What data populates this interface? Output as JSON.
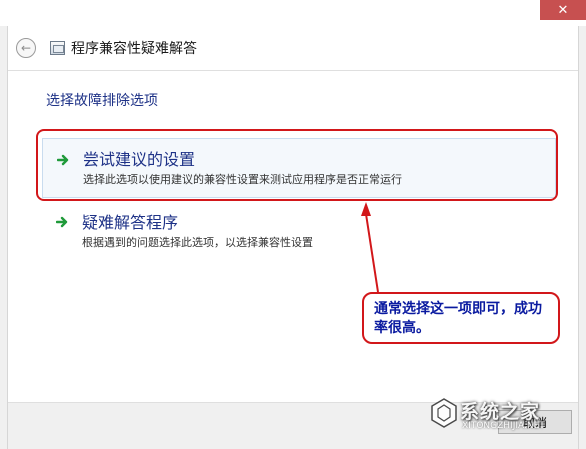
{
  "window": {
    "title": "程序兼容性疑难解答",
    "close_label": "✕"
  },
  "main": {
    "heading": "选择故障排除选项",
    "options": [
      {
        "title": "尝试建议的设置",
        "description": "选择此选项以使用建议的兼容性设置来测试应用程序是否正常运行"
      },
      {
        "title": "疑难解答程序",
        "description": "根据遇到的问题选择此选项，以选择兼容性设置"
      }
    ]
  },
  "footer": {
    "cancel_label": "取消"
  },
  "annotation": {
    "callout_text": "通常选择这一项即可，成功率很高。",
    "color": "#d2171a"
  },
  "watermark": {
    "text": "系统之家",
    "sub": "XITONGZHIJIA.NET"
  },
  "colors": {
    "link_blue": "#1e3287",
    "callout_blue": "#0a1aa0",
    "arrow_green": "#1f9a3a"
  },
  "icons": {
    "back": "back-arrow-icon",
    "app": "compatibility-troubleshooter-icon",
    "option_arrow": "green-arrow-icon"
  }
}
